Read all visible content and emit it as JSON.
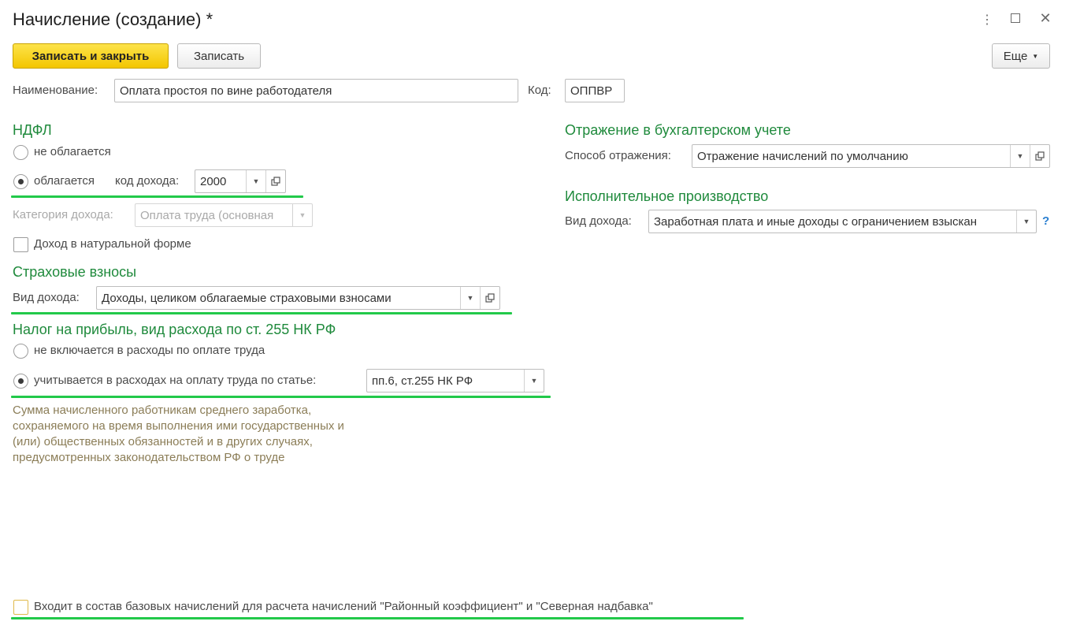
{
  "window": {
    "title": "Начисление (создание) *"
  },
  "toolbar": {
    "save_close_label": "Записать и закрыть",
    "save_label": "Записать",
    "more_label": "Еще"
  },
  "header": {
    "name_label": "Наименование:",
    "name_value": "Оплата простоя по вине работодателя",
    "code_label": "Код:",
    "code_value": "ОППВР"
  },
  "ndfl": {
    "title": "НДФЛ",
    "option_not_taxed": "не облагается",
    "option_taxed": "облагается",
    "selected": "облагается",
    "income_code_label": "код дохода:",
    "income_code_value": "2000",
    "income_category_label": "Категория дохода:",
    "income_category_value": "Оплата труда (основная",
    "natural_income_label": "Доход в натуральной форме",
    "natural_income_checked": false
  },
  "insurance": {
    "title": "Страховые взносы",
    "income_type_label": "Вид дохода:",
    "income_type_value": "Доходы, целиком облагаемые страховыми взносами"
  },
  "profit_tax": {
    "title": "Налог на прибыль, вид расхода по ст. 255 НК РФ",
    "option_excluded": "не включается в расходы по оплате труда",
    "option_included": "учитывается в расходах на оплату труда по статье:",
    "selected": "учитывается в расходах на оплату труда по статье:",
    "article_value": "пп.6, ст.255 НК РФ",
    "note": "Сумма начисленного работникам среднего заработка,\nсохраняемого на время выполнения ими государственных и\n(или) общественных обязанностей и в других случаях,\nпредусмотренных законодательством РФ о труде"
  },
  "accounting": {
    "title": "Отражение в бухгалтерском учете",
    "method_label": "Способ отражения:",
    "method_value": "Отражение начислений по умолчанию"
  },
  "enforcement": {
    "title": "Исполнительное производство",
    "income_type_label": "Вид дохода:",
    "income_type_value": "Заработная плата и иные доходы с ограничением взыскан",
    "help_label": "?"
  },
  "footer": {
    "base_accrual_label": "Входит в состав базовых начислений для расчета начислений \"Районный коэффициент\" и \"Северная надбавка\"",
    "base_accrual_checked": false
  },
  "colors": {
    "section_title": "#1f8a3c",
    "highlight": "#22c94a",
    "primary_button": "#f3c600",
    "note_text": "#8b7d57"
  }
}
